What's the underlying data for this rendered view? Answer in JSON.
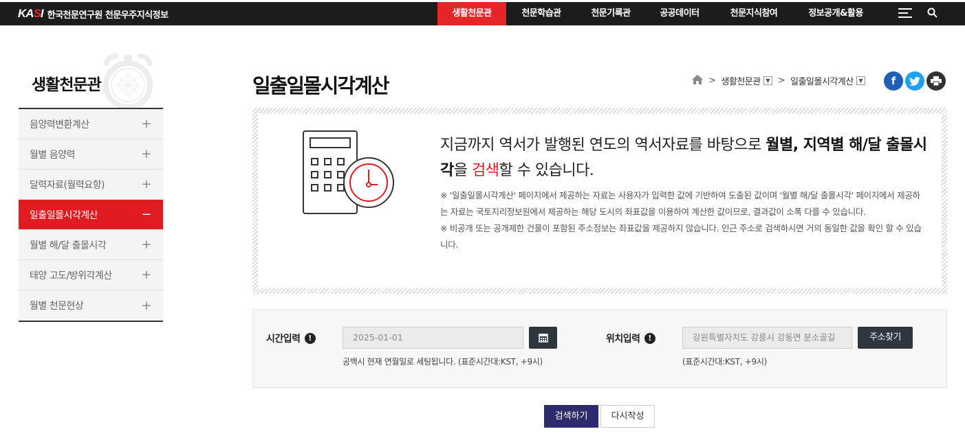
{
  "site": {
    "logo": "KASI",
    "name": "한국천문연구원 천문우주지식정보"
  },
  "gnb": [
    {
      "label": "생활천문관",
      "active": true
    },
    {
      "label": "천문학습관",
      "active": false
    },
    {
      "label": "천문기록관",
      "active": false
    },
    {
      "label": "공공데이터",
      "active": false
    },
    {
      "label": "천문지식참여",
      "active": false
    },
    {
      "label": "정보공개&활용",
      "active": false
    }
  ],
  "sidebar": {
    "title": "생활천문관",
    "items": [
      {
        "label": "음양력변환계산",
        "sign": "+"
      },
      {
        "label": "월별 음양력",
        "sign": "+"
      },
      {
        "label": "달력자료(월력요항)",
        "sign": "+"
      },
      {
        "label": "일출일몰시각계산",
        "sign": "−"
      },
      {
        "label": "월별 해/달 출몰시각",
        "sign": "+"
      },
      {
        "label": "태양 고도/방위각계산",
        "sign": "+"
      },
      {
        "label": "월별 천문현상",
        "sign": "+"
      }
    ]
  },
  "page": {
    "title": "일출일몰시각계산",
    "breadcrumb": [
      "생활천문관",
      "일출일몰시각계산"
    ]
  },
  "share": {
    "facebook": "f",
    "twitter": "t",
    "print": "print"
  },
  "intro": {
    "lead_1": "지금까지 역서가 발행된 연도의 역서자료를 바탕으로 ",
    "lead_bold": "월별, 지역별 해/달 출몰시각",
    "lead_2": "을 ",
    "lead_red": "검색",
    "lead_3": "할 수 있습니다.",
    "note_1": "※ '일출일몰시각계산' 페이지에서 제공하는 자료는 사용자가 입력한 값에 기반하여 도출된 값이며 '월별 해/달 출몰시각' 페이지에서 제공하는 자료는 국토지리정보원에서 제공하는 해당 도시의 좌표값을 이용하여 계산한 값이므로, 결과값이 소폭 다를 수 있습니다.",
    "note_2": "※ 비공개 또는 공개제한 건물이 포함된 주소정보는 좌표값을 제공하지 않습니다. 인근 주소로 검색하시면 거의 동일한 값을 확인 할 수 있습니다."
  },
  "form": {
    "time_label": "시간입력",
    "date_value": "2025-01-01",
    "time_hint": "공백시 현재 연월일로 세팅됩니다. (표준시간대:KST, +9시)",
    "location_label": "위치입력",
    "location_value": "강원특별자치도 강릉시 강동면 분소골길",
    "address_button": "주소찾기",
    "location_hint": "(표준시간대:KST, +9시)"
  },
  "actions": {
    "search": "검색하기",
    "reset": "다시작성"
  },
  "colors": {
    "accent_red": "#e11b22",
    "topbar": "#1c1c1c",
    "button_dark": "#2e3640",
    "button_search": "#2d2a6e",
    "facebook": "#1f5fb8",
    "twitter": "#1da1f2",
    "print": "#333333"
  }
}
